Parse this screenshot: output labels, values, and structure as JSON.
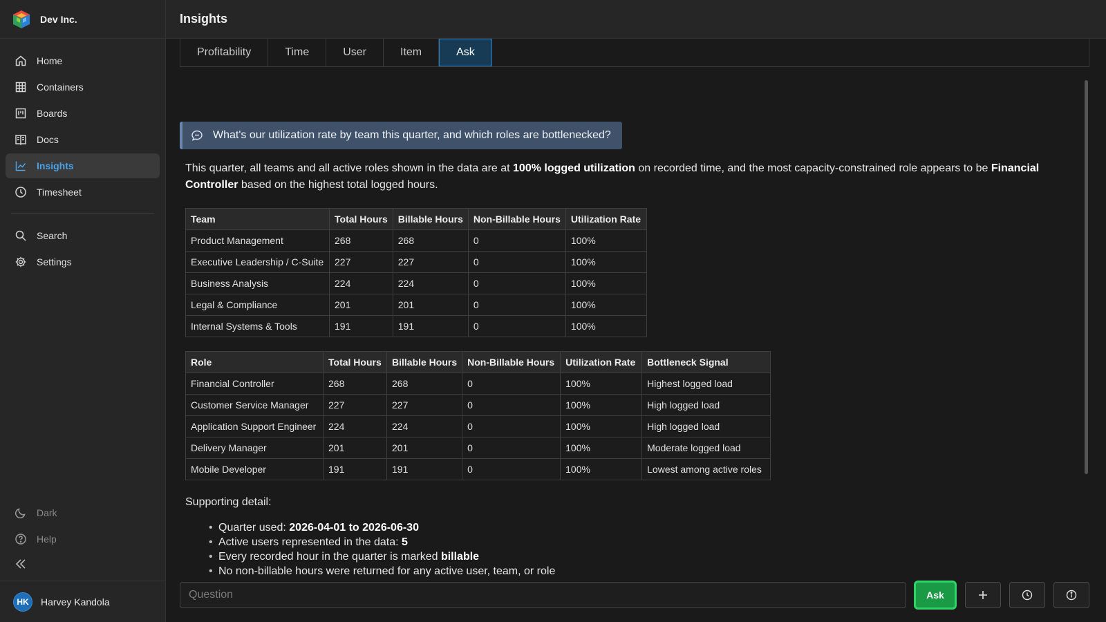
{
  "brand": {
    "name": "Dev Inc.",
    "logo_icon": "cube-logo-icon"
  },
  "sidebar": {
    "items": [
      {
        "label": "Home",
        "icon": "home-icon"
      },
      {
        "label": "Containers",
        "icon": "grid-icon"
      },
      {
        "label": "Boards",
        "icon": "board-icon"
      },
      {
        "label": "Docs",
        "icon": "book-icon"
      },
      {
        "label": "Insights",
        "icon": "chart-icon",
        "active": true
      },
      {
        "label": "Timesheet",
        "icon": "clock-icon"
      }
    ],
    "secondary": [
      {
        "label": "Search",
        "icon": "search-icon"
      },
      {
        "label": "Settings",
        "icon": "gear-icon"
      }
    ],
    "bottom": [
      {
        "label": "Dark",
        "icon": "moon-icon"
      },
      {
        "label": "Help",
        "icon": "help-icon"
      }
    ],
    "user": {
      "initials": "HK",
      "name": "Harvey Kandola"
    }
  },
  "header": {
    "title": "Insights"
  },
  "tabs": [
    {
      "label": "Profitability"
    },
    {
      "label": "Time"
    },
    {
      "label": "User"
    },
    {
      "label": "Item"
    },
    {
      "label": "Ask",
      "active": true
    }
  ],
  "question": {
    "text": "What's our utilization rate by team this quarter, and which roles are bottlenecked?"
  },
  "answer": {
    "p1": "This quarter, all teams and all active roles shown in the data are at ",
    "p1_bold": "100% logged utilization",
    "p2": " on recorded time, and the most capacity-constrained role appears to be ",
    "p2_bold": "Financial Controller",
    "p3": " based on the highest total logged hours."
  },
  "team_table": {
    "headers": [
      "Team",
      "Total Hours",
      "Billable Hours",
      "Non-Billable Hours",
      "Utilization Rate"
    ],
    "rows": [
      [
        "Product Management",
        "268",
        "268",
        "0",
        "100%"
      ],
      [
        "Executive Leadership / C-Suite",
        "227",
        "227",
        "0",
        "100%"
      ],
      [
        "Business Analysis",
        "224",
        "224",
        "0",
        "100%"
      ],
      [
        "Legal & Compliance",
        "201",
        "201",
        "0",
        "100%"
      ],
      [
        "Internal Systems & Tools",
        "191",
        "191",
        "0",
        "100%"
      ]
    ]
  },
  "role_table": {
    "headers": [
      "Role",
      "Total Hours",
      "Billable Hours",
      "Non-Billable Hours",
      "Utilization Rate",
      "Bottleneck Signal"
    ],
    "rows": [
      [
        "Financial Controller",
        "268",
        "268",
        "0",
        "100%",
        "Highest logged load"
      ],
      [
        "Customer Service Manager",
        "227",
        "227",
        "0",
        "100%",
        "High logged load"
      ],
      [
        "Application Support Engineer",
        "224",
        "224",
        "0",
        "100%",
        "High logged load"
      ],
      [
        "Delivery Manager",
        "201",
        "201",
        "0",
        "100%",
        "Moderate logged load"
      ],
      [
        "Mobile Developer",
        "191",
        "191",
        "0",
        "100%",
        "Lowest among active roles"
      ]
    ]
  },
  "support": {
    "title": "Supporting detail:",
    "bullets": [
      {
        "text": "Quarter used: ",
        "bold": "2026-04-01 to 2026-06-30"
      },
      {
        "text": "Active users represented in the data: ",
        "bold": "5"
      },
      {
        "text": "Every recorded hour in the quarter is marked ",
        "bold": "billable"
      },
      {
        "text": "No non-billable hours were returned for any active user, team, or role",
        "bold": ""
      }
    ]
  },
  "ask_bar": {
    "placeholder": "Question",
    "value": "",
    "ask_label": "Ask",
    "buttons": [
      "plus-icon",
      "history-icon",
      "info-icon"
    ]
  },
  "colors": {
    "accent": "#4aa3e8",
    "ask_green": "#1a9a44",
    "active_tab": "#173b55"
  }
}
